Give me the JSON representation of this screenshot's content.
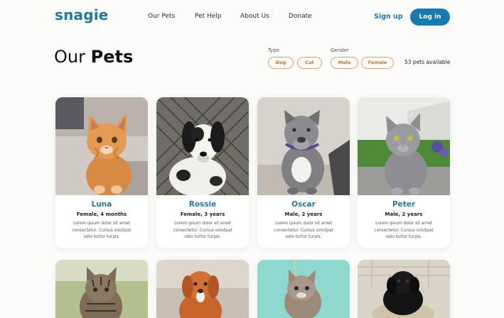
{
  "brand": {
    "logo": "snagie"
  },
  "nav": [
    "Our Pets",
    "Pet Help",
    "About Us",
    "Donate"
  ],
  "auth": {
    "signup": "Sign up",
    "login": "Log in"
  },
  "page": {
    "title_light": "Our ",
    "title_bold": "Pets"
  },
  "filters": {
    "type": {
      "label": "Type",
      "options": [
        "Dog",
        "Cat"
      ]
    },
    "gender": {
      "label": "Gender",
      "options": [
        "Male",
        "Female"
      ]
    },
    "count": "53 pets available"
  },
  "pets": [
    {
      "name": "Luna",
      "meta": "Female, 4 months",
      "desc": "Lorem ipsum dolor sit amet consectetur. Cursus volutpat odio tortor turpis."
    },
    {
      "name": "Rossie",
      "meta": "Female, 3 years",
      "desc": "Lorem ipsum dolor sit amet consectetur. Cursus volutpat odio tortor turpis."
    },
    {
      "name": "Oscar",
      "meta": "Male, 2 years",
      "desc": "Lorem ipsum dolor sit amet consectetur. Cursus volutpat odio tortor turpis."
    },
    {
      "name": "Peter",
      "meta": "Male, 2 years",
      "desc": "Lorem ipsum dolor sit amet consectetur. Cursus volutpat odio tortor turpis."
    }
  ],
  "colors": {
    "brand": "#1f7aa3",
    "button": "#167bb1",
    "chip_border": "#e0a46a",
    "chip_text": "#b8722d"
  }
}
